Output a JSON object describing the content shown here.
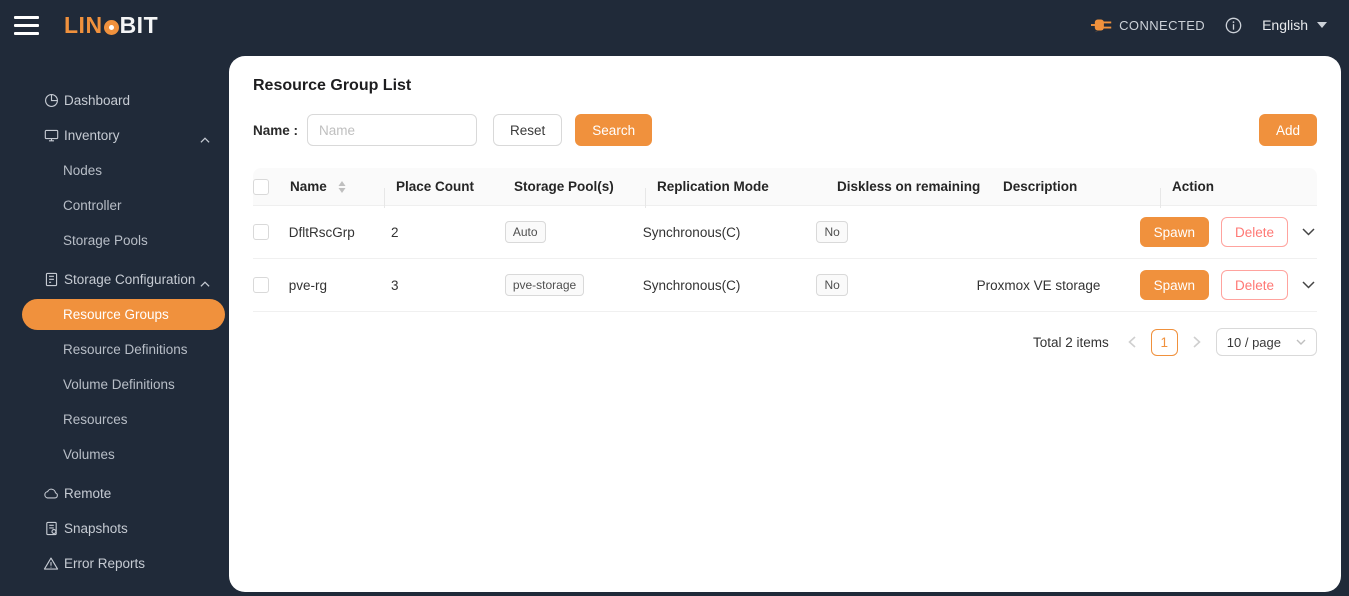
{
  "colors": {
    "accent": "#F0913D",
    "dark_background": "#202A39",
    "danger_border": "#FFA39E",
    "danger_text": "#FF7875"
  },
  "topbar": {
    "logo_lin": "LIN",
    "logo_bit": "BIT",
    "connection_status": "CONNECTED",
    "language": "English",
    "icons": [
      "hamburger-icon",
      "plug-icon",
      "info-circle-icon",
      "caret-down-icon"
    ]
  },
  "sidebar": {
    "dashboard": "Dashboard",
    "inventory": "Inventory",
    "nodes": "Nodes",
    "controller": "Controller",
    "storage_pools": "Storage Pools",
    "storage_configuration": "Storage Configuration",
    "resource_groups": "Resource Groups",
    "resource_definitions": "Resource Definitions",
    "volume_definitions": "Volume Definitions",
    "resources": "Resources",
    "volumes": "Volumes",
    "remote": "Remote",
    "snapshots": "Snapshots",
    "error_reports": "Error Reports",
    "active_item": "Resource Groups"
  },
  "main": {
    "title": "Resource Group List",
    "filter": {
      "label": "Name :",
      "placeholder": "Name",
      "value": "",
      "reset_label": "Reset",
      "search_label": "Search",
      "add_label": "Add"
    },
    "table": {
      "headers": {
        "name": "Name",
        "place_count": "Place Count",
        "storage_pools": "Storage Pool(s)",
        "replication_mode": "Replication Mode",
        "diskless": "Diskless on remaining",
        "description": "Description",
        "action": "Action"
      },
      "rows": [
        {
          "name": "DfltRscGrp",
          "place_count": "2",
          "storage_pool_tag": "Auto",
          "replication_mode": "Synchronous(C)",
          "diskless_tag": "No",
          "description": "",
          "spawn_label": "Spawn",
          "delete_label": "Delete"
        },
        {
          "name": "pve-rg",
          "place_count": "3",
          "storage_pool_tag": "pve-storage",
          "replication_mode": "Synchronous(C)",
          "diskless_tag": "No",
          "description": "Proxmox VE storage",
          "spawn_label": "Spawn",
          "delete_label": "Delete"
        }
      ]
    },
    "pagination": {
      "total_text": "Total 2 items",
      "current_page": "1",
      "page_size": "10 / page"
    }
  }
}
